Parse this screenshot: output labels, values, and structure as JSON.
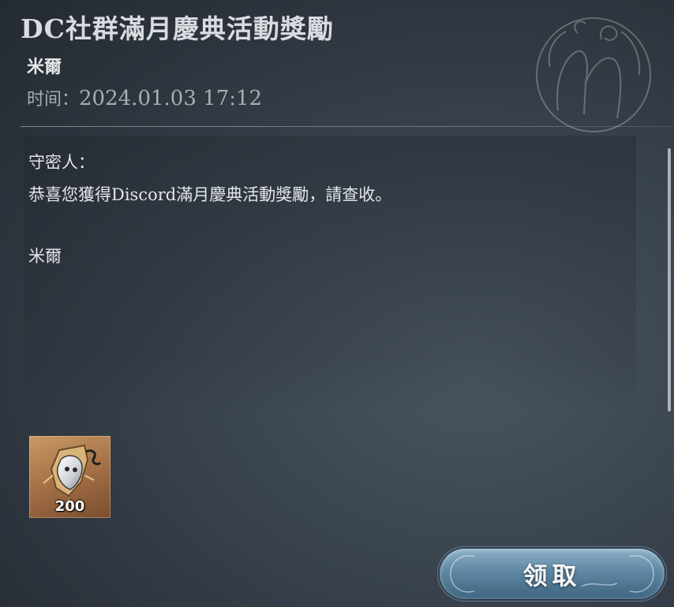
{
  "mail": {
    "title": "DC社群滿月慶典活動獎勵",
    "sender": "米爾",
    "time_label": "时间：",
    "time_value": "2024.01.03 17:12"
  },
  "body": {
    "greeting": "守密人：",
    "message": "恭喜您獲得Discord滿月慶典活動獎勵，請查收。",
    "signature": "米爾"
  },
  "reward": {
    "icon": "mask-shard-icon",
    "count": "200"
  },
  "actions": {
    "claim_label": "领取"
  },
  "colors": {
    "background": "#3a444f",
    "button": "#5f87a3",
    "reward_frame": "#a8744a"
  }
}
